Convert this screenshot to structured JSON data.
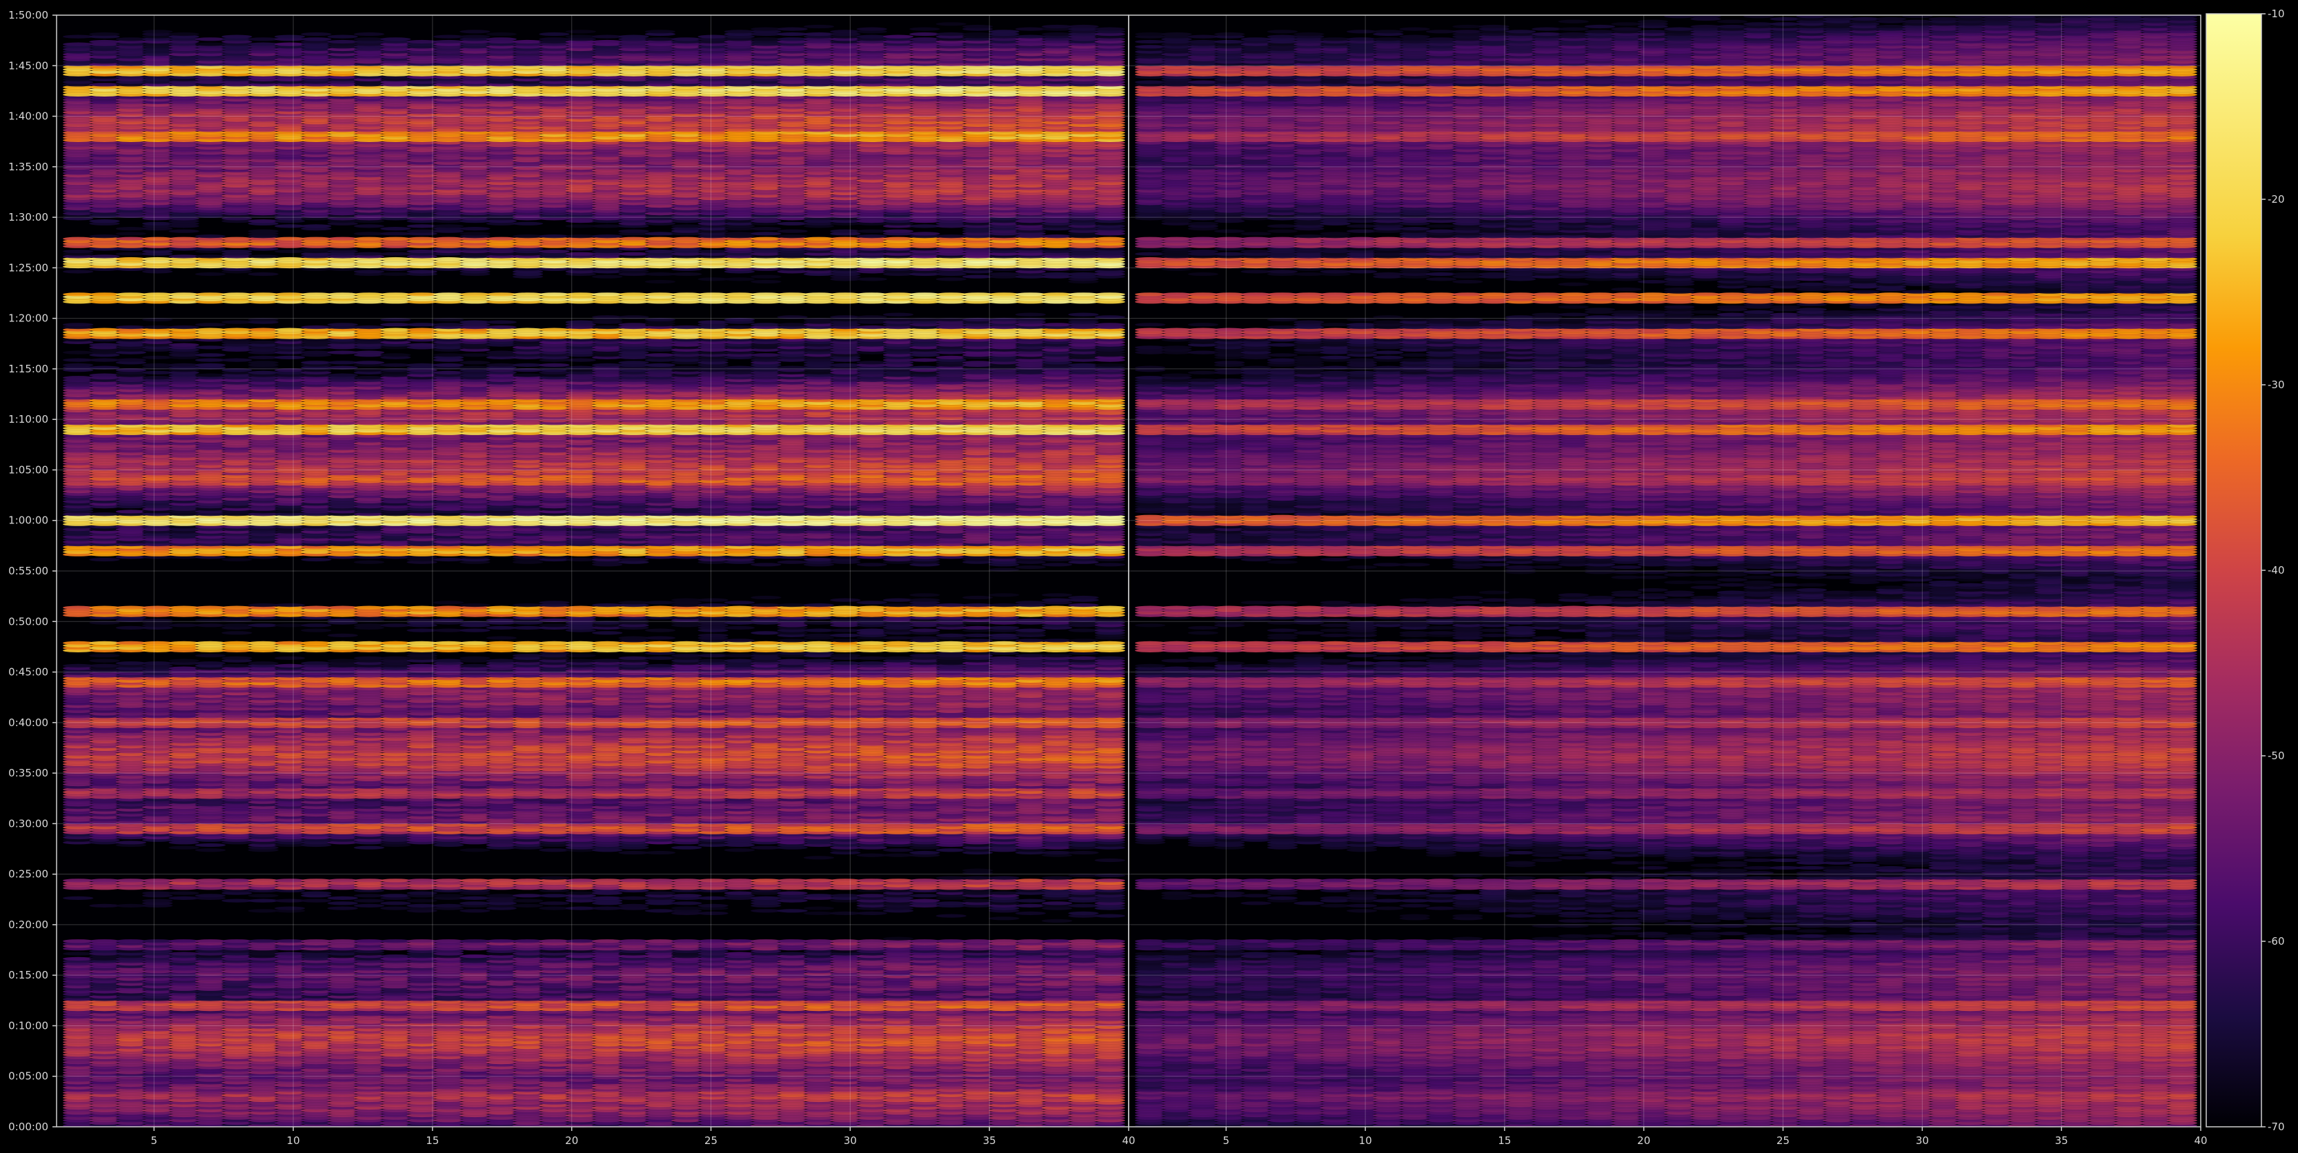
{
  "chart_data": {
    "type": "heatmap",
    "panels": [
      {
        "name": "left",
        "x_ticks": [
          5,
          10,
          15,
          20,
          25,
          30,
          35,
          40
        ],
        "xlim": [
          1.5,
          40
        ],
        "intensity_scale": 1.0
      },
      {
        "name": "right",
        "x_ticks": [
          5,
          10,
          15,
          20,
          25,
          30,
          35,
          40
        ],
        "xlim": [
          1.5,
          40
        ],
        "intensity_scale": 0.62
      }
    ],
    "y_ticks": [
      "0:00:00",
      "0:05:00",
      "0:10:00",
      "0:15:00",
      "0:20:00",
      "0:25:00",
      "0:30:00",
      "0:35:00",
      "0:40:00",
      "0:45:00",
      "0:50:00",
      "0:55:00",
      "1:00:00",
      "1:05:00",
      "1:10:00",
      "1:15:00",
      "1:20:00",
      "1:25:00",
      "1:30:00",
      "1:35:00",
      "1:40:00",
      "1:45:00",
      "1:50:00"
    ],
    "ylim_minutes": [
      0,
      110
    ],
    "colorbar": {
      "colormap": "inferno",
      "range": [
        -70,
        -10
      ],
      "ticks": [
        "-10",
        "-20",
        "-30",
        "-40",
        "-50",
        "-60",
        "-70"
      ]
    },
    "bright_rows_minutes": [
      3,
      7,
      12,
      18,
      24,
      29.5,
      33,
      37,
      40,
      44,
      47.5,
      51,
      57,
      60,
      64,
      69,
      71.5,
      78.5,
      82,
      85.5,
      87.5,
      98,
      102.5,
      104.5
    ],
    "row_levels_dbfs": [
      -45,
      -50,
      -40,
      -55,
      -45,
      -40,
      -45,
      -42,
      -40,
      -35,
      -25,
      -30,
      -28,
      -15,
      -38,
      -22,
      -30,
      -25,
      -20,
      -18,
      -35,
      -30,
      -20,
      -22
    ],
    "grid": true
  }
}
